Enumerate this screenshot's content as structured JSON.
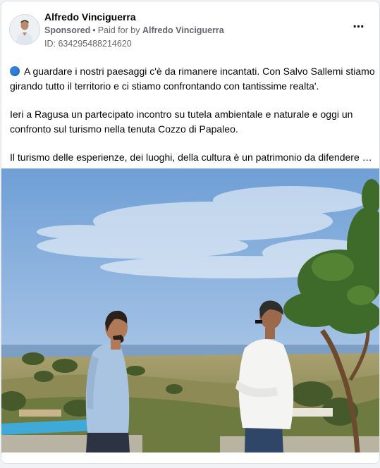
{
  "post": {
    "author": "Alfredo Vinciguerra",
    "sponsored_label": "Sponsored",
    "paid_for_prefix": "Paid for by",
    "paid_for_name": "Alfredo Vinciguerra",
    "ad_id": "ID: 634295488214620",
    "more_icon": "⋯",
    "paragraph_1": "A guardare i nostri paesaggi c'è da rimanere incantati. Con Salvo Sallemi stiamo girando tutto il territorio e ci stiamo confrontando con tantissime realta'.",
    "paragraph_2": "Ieri a Ragusa un partecipato incontro su tutela ambientale e naturale e oggi un confronto sul turismo nella tenuta Cozzo di Papaleo.",
    "paragraph_3": "Il turismo delle esperienze, dei luoghi, della cultura è un patrimonio da difendere e..."
  },
  "colors": {
    "accent_dot": "#2f7fd8",
    "meta_text": "#65676b",
    "sky_top": "#6f9fd6",
    "sky_bottom": "#c9dcef"
  },
  "icons": {
    "more": "more-options-icon",
    "bullet": "blue-circle-icon"
  }
}
